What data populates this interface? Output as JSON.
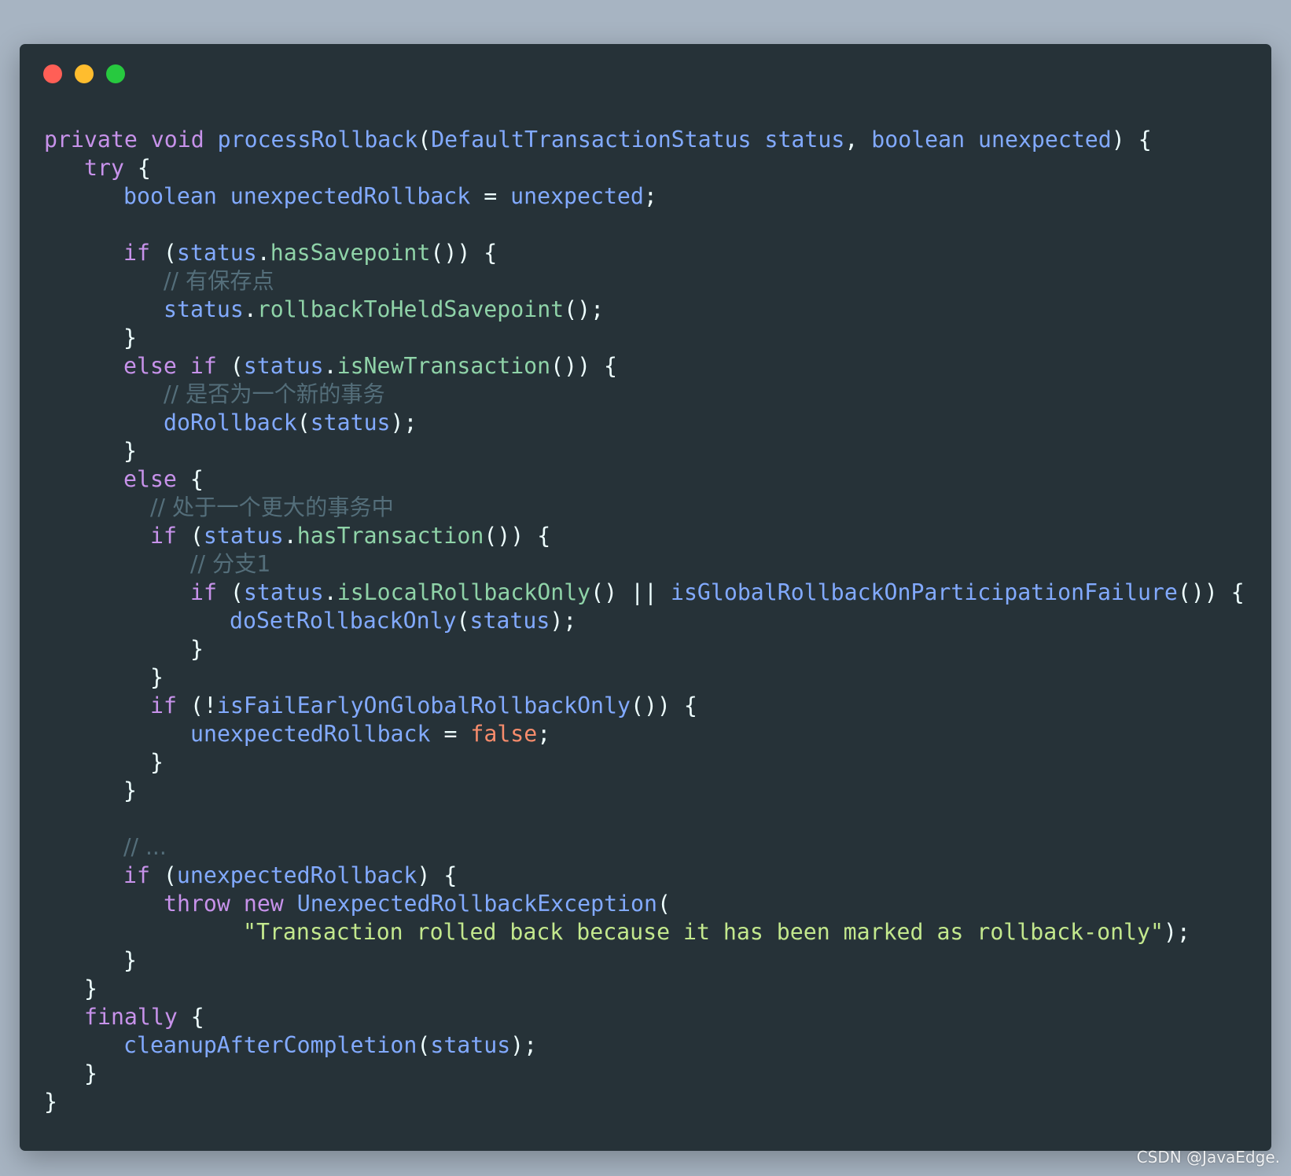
{
  "window": {
    "controls": [
      {
        "name": "close",
        "color": "#ff5f56"
      },
      {
        "name": "minimize",
        "color": "#ffbd2e"
      },
      {
        "name": "maximize",
        "color": "#27c93f"
      }
    ]
  },
  "colors": {
    "background": "#a7b4c2",
    "editor": "#263238",
    "keyword": "#c792ea",
    "identifier": "#82aaff",
    "method": "#8fd3a8",
    "comment": "#546e7a",
    "string": "#c3e88d",
    "boolean": "#f78c6c",
    "punctuation": "#eeffff"
  },
  "code": {
    "language": "java",
    "lines": [
      {
        "indent": 0,
        "tokens": [
          [
            "private",
            "kw"
          ],
          [
            " ",
            "pun"
          ],
          [
            "void",
            "kw"
          ],
          [
            " ",
            "pun"
          ],
          [
            "processRollback",
            "fn"
          ],
          [
            "(",
            "pun"
          ],
          [
            "DefaultTransactionStatus",
            "ty"
          ],
          [
            " ",
            "pun"
          ],
          [
            "status",
            "var"
          ],
          [
            ", ",
            "pun"
          ],
          [
            "boolean",
            "ty"
          ],
          [
            " ",
            "pun"
          ],
          [
            "unexpected",
            "var"
          ],
          [
            ") {",
            "pun"
          ]
        ]
      },
      {
        "indent": 1,
        "tokens": [
          [
            "try",
            "kw"
          ],
          [
            " {",
            "pun"
          ]
        ]
      },
      {
        "indent": 2,
        "tokens": [
          [
            "boolean",
            "ty"
          ],
          [
            " ",
            "pun"
          ],
          [
            "unexpectedRollback",
            "var"
          ],
          [
            " = ",
            "pun"
          ],
          [
            "unexpected",
            "var"
          ],
          [
            ";",
            "pun"
          ]
        ]
      },
      {
        "indent": 0,
        "tokens": []
      },
      {
        "indent": 2,
        "tokens": [
          [
            "if",
            "kw"
          ],
          [
            " (",
            "pun"
          ],
          [
            "status",
            "var"
          ],
          [
            ".",
            "pun"
          ],
          [
            "hasSavepoint",
            "mth"
          ],
          [
            "()) {",
            "pun"
          ]
        ]
      },
      {
        "indent": 4,
        "tokens": [
          [
            "// 有保存点",
            "cm"
          ]
        ]
      },
      {
        "indent": 4,
        "tokens": [
          [
            "status",
            "var"
          ],
          [
            ".",
            "pun"
          ],
          [
            "rollbackToHeldSavepoint",
            "mth"
          ],
          [
            "();",
            "pun"
          ]
        ]
      },
      {
        "indent": 2,
        "tokens": [
          [
            "}",
            "pun"
          ]
        ]
      },
      {
        "indent": 2,
        "tokens": [
          [
            "else",
            "kw"
          ],
          [
            " ",
            "pun"
          ],
          [
            "if",
            "kw"
          ],
          [
            " (",
            "pun"
          ],
          [
            "status",
            "var"
          ],
          [
            ".",
            "pun"
          ],
          [
            "isNewTransaction",
            "mth"
          ],
          [
            "()) {",
            "pun"
          ]
        ]
      },
      {
        "indent": 4,
        "tokens": [
          [
            "// 是否为一个新的事务",
            "cm"
          ]
        ]
      },
      {
        "indent": 4,
        "tokens": [
          [
            "doRollback",
            "fn"
          ],
          [
            "(",
            "pun"
          ],
          [
            "status",
            "var"
          ],
          [
            ");",
            "pun"
          ]
        ]
      },
      {
        "indent": 2,
        "tokens": [
          [
            "}",
            "pun"
          ]
        ]
      },
      {
        "indent": 2,
        "tokens": [
          [
            "else",
            "kw"
          ],
          [
            " {",
            "pun"
          ]
        ]
      },
      {
        "indent": 3,
        "tokens": [
          [
            "// 处于一个更大的事务中",
            "cm"
          ]
        ]
      },
      {
        "indent": 3,
        "tokens": [
          [
            "if",
            "kw"
          ],
          [
            " (",
            "pun"
          ],
          [
            "status",
            "var"
          ],
          [
            ".",
            "pun"
          ],
          [
            "hasTransaction",
            "mth"
          ],
          [
            "()) {",
            "pun"
          ]
        ]
      },
      {
        "indent": 5,
        "tokens": [
          [
            "// 分支1",
            "cm"
          ]
        ]
      },
      {
        "indent": 5,
        "tokens": [
          [
            "if",
            "kw"
          ],
          [
            " (",
            "pun"
          ],
          [
            "status",
            "var"
          ],
          [
            ".",
            "pun"
          ],
          [
            "isLocalRollbackOnly",
            "mth"
          ],
          [
            "() || ",
            "pun"
          ],
          [
            "isGlobalRollbackOnParticipationFailure",
            "fn"
          ],
          [
            "()) {",
            "pun"
          ]
        ]
      },
      {
        "indent": 6,
        "tokens": [
          [
            "doSetRollbackOnly",
            "fn"
          ],
          [
            "(",
            "pun"
          ],
          [
            "status",
            "var"
          ],
          [
            ");",
            "pun"
          ]
        ]
      },
      {
        "indent": 5,
        "tokens": [
          [
            "}",
            "pun"
          ]
        ]
      },
      {
        "indent": 3,
        "tokens": [
          [
            "}",
            "pun"
          ]
        ]
      },
      {
        "indent": 3,
        "tokens": [
          [
            "if",
            "kw"
          ],
          [
            " (!",
            "pun"
          ],
          [
            "isFailEarlyOnGlobalRollbackOnly",
            "fn"
          ],
          [
            "()) {",
            "pun"
          ]
        ]
      },
      {
        "indent": 5,
        "tokens": [
          [
            "unexpectedRollback",
            "var"
          ],
          [
            " = ",
            "pun"
          ],
          [
            "false",
            "bool"
          ],
          [
            ";",
            "pun"
          ]
        ]
      },
      {
        "indent": 3,
        "tokens": [
          [
            "}",
            "pun"
          ]
        ]
      },
      {
        "indent": 2,
        "tokens": [
          [
            "}",
            "pun"
          ]
        ]
      },
      {
        "indent": 0,
        "tokens": []
      },
      {
        "indent": 2,
        "tokens": [
          [
            "// ...",
            "cm"
          ]
        ]
      },
      {
        "indent": 2,
        "tokens": [
          [
            "if",
            "kw"
          ],
          [
            " (",
            "pun"
          ],
          [
            "unexpectedRollback",
            "var"
          ],
          [
            ") {",
            "pun"
          ]
        ]
      },
      {
        "indent": 4,
        "tokens": [
          [
            "throw",
            "kw"
          ],
          [
            " ",
            "pun"
          ],
          [
            "new",
            "kw"
          ],
          [
            " ",
            "pun"
          ],
          [
            "UnexpectedRollbackException",
            "ty"
          ],
          [
            "(",
            "pun"
          ]
        ]
      },
      {
        "indent": 7,
        "tokens": [
          [
            "\"Transaction rolled back because it has been marked as rollback-only\"",
            "str"
          ],
          [
            ");",
            "pun"
          ]
        ]
      },
      {
        "indent": 2,
        "tokens": [
          [
            "}",
            "pun"
          ]
        ]
      },
      {
        "indent": 1,
        "tokens": [
          [
            "}",
            "pun"
          ]
        ]
      },
      {
        "indent": 1,
        "tokens": [
          [
            "finally",
            "kw"
          ],
          [
            " {",
            "pun"
          ]
        ]
      },
      {
        "indent": 2,
        "tokens": [
          [
            "cleanupAfterCompletion",
            "fn"
          ],
          [
            "(",
            "pun"
          ],
          [
            "status",
            "var"
          ],
          [
            ");",
            "pun"
          ]
        ]
      },
      {
        "indent": 1,
        "tokens": [
          [
            "}",
            "pun"
          ]
        ]
      },
      {
        "indent": 0,
        "tokens": [
          [
            "}",
            "pun"
          ]
        ]
      }
    ]
  },
  "watermark": "CSDN @JavaEdge."
}
